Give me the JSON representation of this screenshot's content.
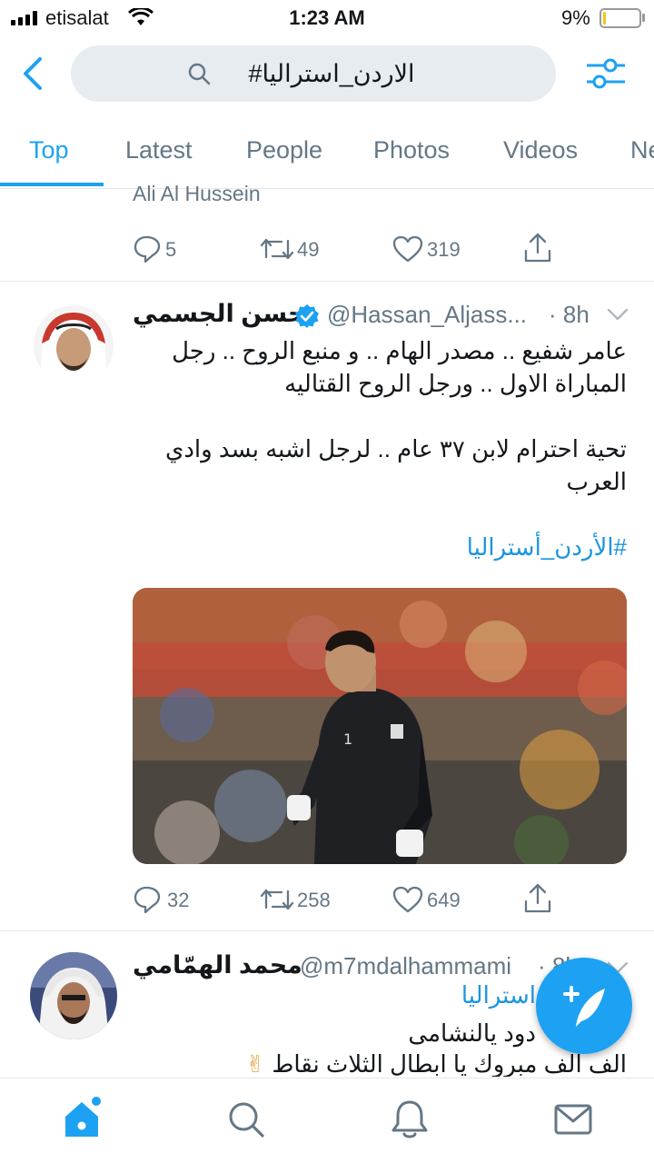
{
  "status_bar": {
    "carrier": "etisalat",
    "time": "1:23 AM",
    "battery_percent": "9%",
    "battery_level": 0.09
  },
  "search": {
    "query": "#الاردن_استراليا"
  },
  "tabs": [
    {
      "label": "Top",
      "active": true
    },
    {
      "label": "Latest"
    },
    {
      "label": "People"
    },
    {
      "label": "Photos"
    },
    {
      "label": "Videos"
    },
    {
      "label": "Ne"
    }
  ],
  "tweet_prev": {
    "author_partial": "Ali Al Hussein",
    "replies": "5",
    "retweets": "49",
    "likes": "319"
  },
  "tweet_main": {
    "name": "حسن الجسمي",
    "verified": true,
    "handle": "@Hassan_Aljass...",
    "time": "· 8h",
    "lines": [
      "عامر شفيع .. مصدر الهام .. و منبع الروح .. رجل",
      "المباراة الاول .. ورجل الروح القتاليه",
      "تحية احترام لابن ٣٧ عام .. لرجل اشبه بسد وادي",
      "العرب"
    ],
    "hashtag": "#الأردن_أستراليا",
    "replies": "32",
    "retweets": "258",
    "likes": "649"
  },
  "tweet_next": {
    "name": "محمد الهمّامي",
    "handle": "@m7mdalhammami",
    "time": "· 8h",
    "hashtag_partial": "استراليا",
    "line1": "دود يالنشامى",
    "line2": "الف الف مبروك يا ابطال الثلاث نقاط",
    "emoji": "✌"
  },
  "colors": {
    "accent": "#1da1f2",
    "secondary_text": "#657786",
    "border": "#e1e8ed",
    "search_bg": "#e6ecf0"
  },
  "icons": [
    "back-arrow-icon",
    "search-icon",
    "filter-icon",
    "reply-icon",
    "retweet-icon",
    "like-icon",
    "share-icon",
    "verified-icon",
    "chevron-down-icon",
    "compose-icon",
    "home-icon",
    "explore-icon",
    "notifications-icon",
    "messages-icon"
  ]
}
